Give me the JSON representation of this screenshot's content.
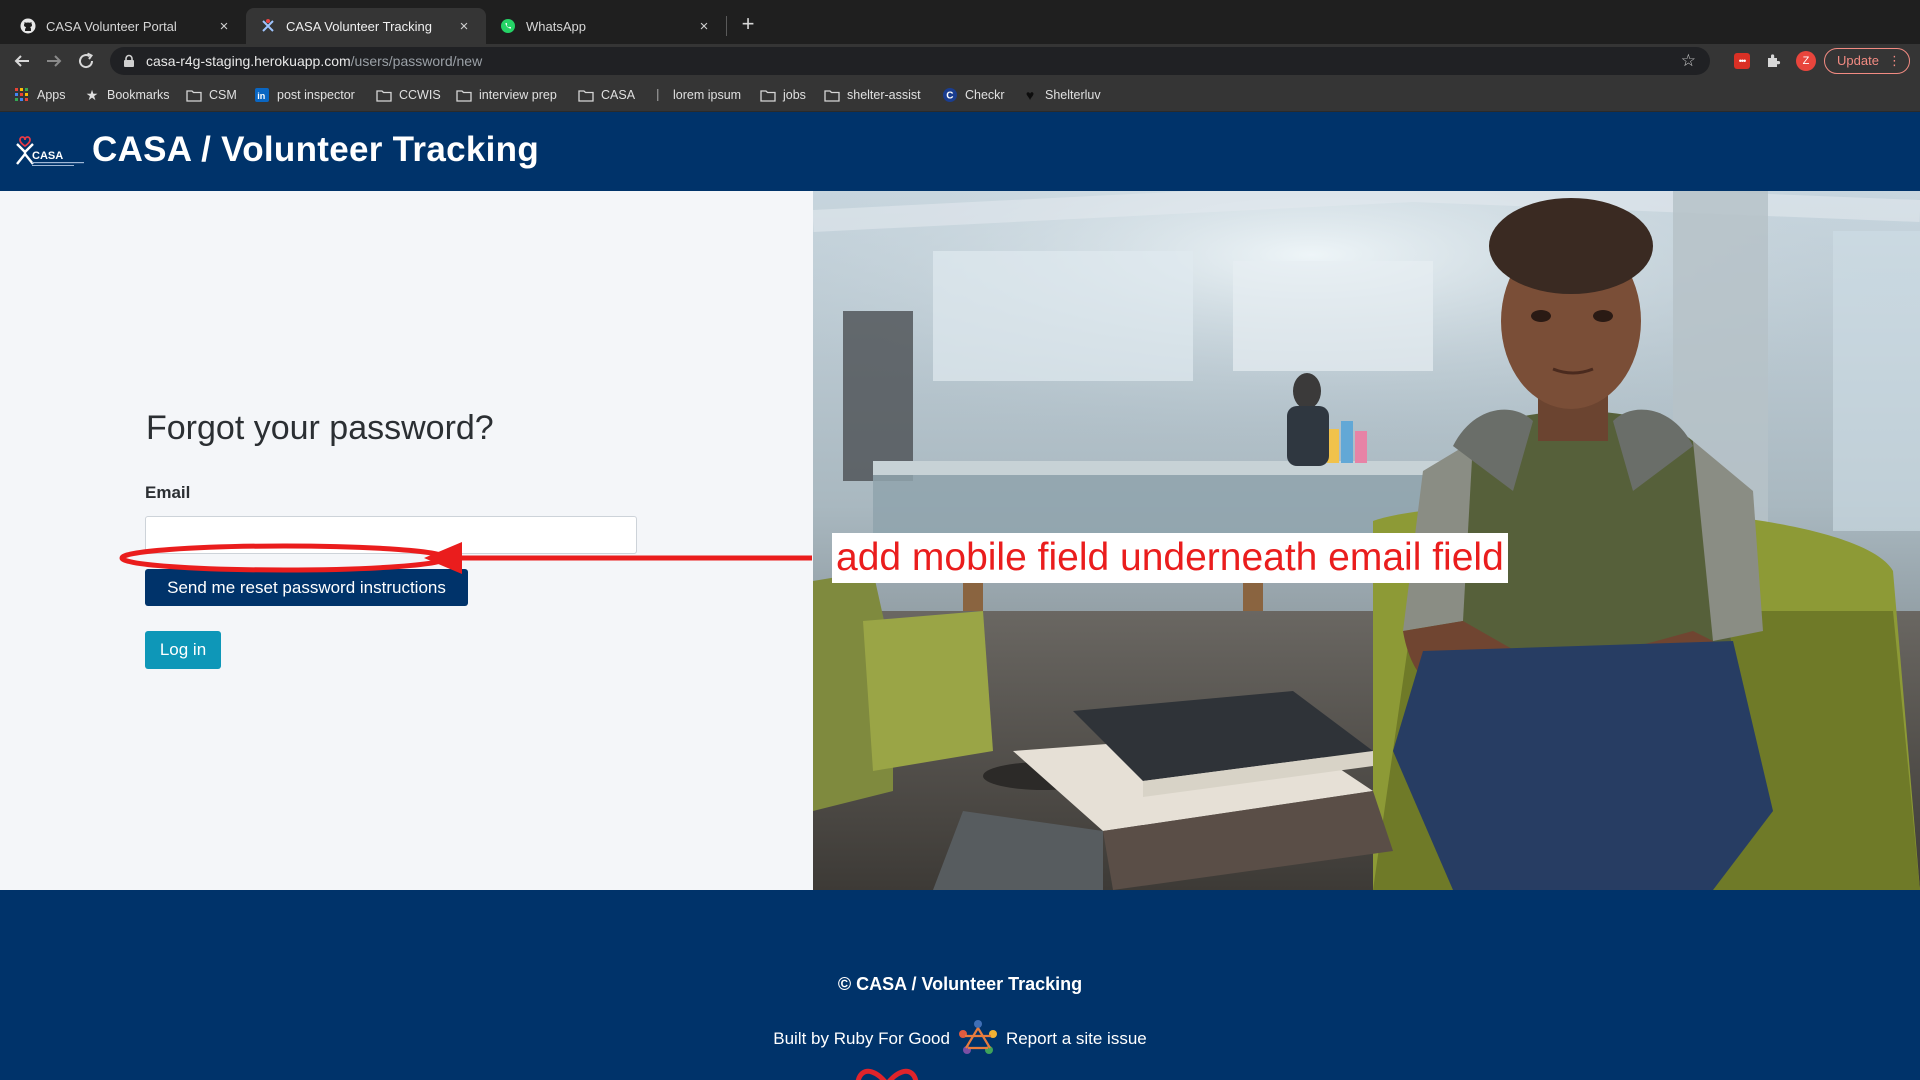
{
  "browser": {
    "tabs": [
      {
        "label": "CASA Volunteer Portal",
        "icon": "github-icon",
        "active": false
      },
      {
        "label": "CASA Volunteer Tracking",
        "icon": "casa-icon",
        "active": true
      },
      {
        "label": "WhatsApp",
        "icon": "whatsapp-icon",
        "active": false
      }
    ],
    "close_glyph": "×",
    "new_tab_glyph": "+",
    "url_host": "casa-r4g-staging.herokuapp.com",
    "url_path": "/users/password/new",
    "update_label": "Update",
    "profile_initial": "Z",
    "bookmarks": [
      {
        "label": "Apps",
        "icon": "apps-grid-icon"
      },
      {
        "label": "Bookmarks",
        "icon": "star-icon"
      },
      {
        "label": "CSM",
        "icon": "folder-icon"
      },
      {
        "label": "post inspector",
        "icon": "linkedin-icon"
      },
      {
        "label": "CCWIS",
        "icon": "folder-icon"
      },
      {
        "label": "interview prep",
        "icon": "folder-icon"
      },
      {
        "label": "CASA",
        "icon": "folder-icon"
      },
      {
        "label": "lorem ipsum",
        "icon": "page-icon"
      },
      {
        "label": "jobs",
        "icon": "folder-icon"
      },
      {
        "label": "shelter-assist",
        "icon": "folder-icon"
      },
      {
        "label": "Checkr",
        "icon": "checkr-icon"
      },
      {
        "label": "Shelterluv",
        "icon": "heart-icon"
      }
    ]
  },
  "site": {
    "title": "CASA / Volunteer Tracking",
    "logo_text": "CASA"
  },
  "form": {
    "heading": "Forgot your password?",
    "email_label": "Email",
    "email_value": "",
    "submit_label": "Send me reset password instructions",
    "login_label": "Log in"
  },
  "annotation": {
    "text": "add mobile field underneath email field",
    "color": "#ea1d1d"
  },
  "footer": {
    "copyright": "© CASA / Volunteer Tracking",
    "built_by": "Built by Ruby For Good",
    "report": "Report a site issue"
  },
  "colors": {
    "brand_navy": "#00336a",
    "login_teal": "#0e97b8",
    "annotation_red": "#ea1d1d"
  }
}
